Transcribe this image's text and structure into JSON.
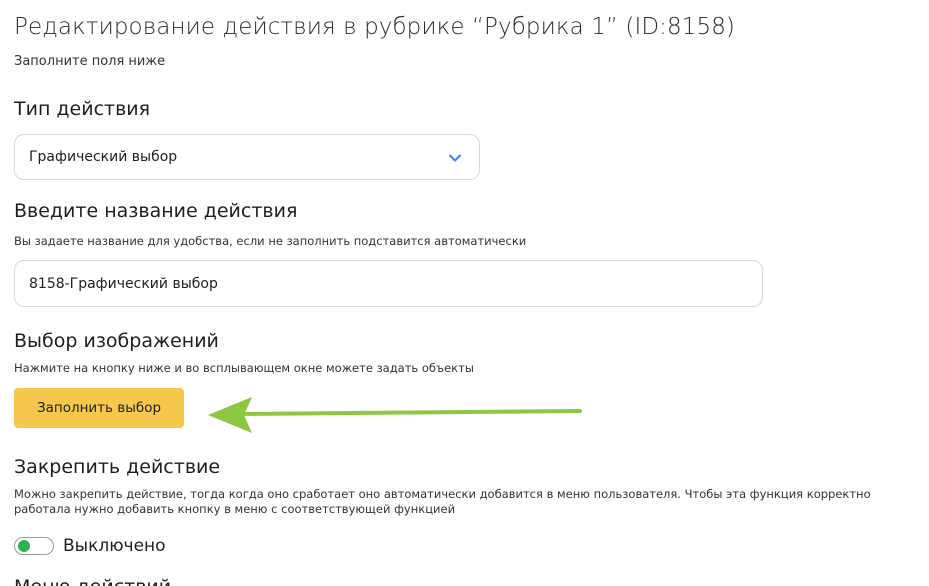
{
  "page": {
    "title": "Редактирование действия в рубрике “Рубрика 1” (ID:8158)",
    "subtitle": "Заполните поля ниже"
  },
  "action_type": {
    "label": "Тип действия",
    "selected_value": "Графический выбор"
  },
  "action_name": {
    "label": "Введите название действия",
    "hint": "Вы задаете название для удобства, если не заполнить подставится автоматически",
    "value": "8158-Графический выбор"
  },
  "image_selection": {
    "label": "Выбор изображений",
    "hint": "Нажмите на кнопку ниже и во всплывающем окне можете задать объекты",
    "button_label": "Заполнить выбор"
  },
  "pin_action": {
    "label": "Закрепить действие",
    "description": "Можно закрепить действие, тогда когда оно сработает оно автоматически добавится в меню пользователя. Чтобы эта функция корректно работала нужно добавить кнопку в меню с соответствующей функцией",
    "toggle_label": "Выключено",
    "toggle_on": false
  },
  "next_section": {
    "label": "Меню действий"
  },
  "colors": {
    "accent_button": "#f5c84c",
    "chevron": "#3b82f6",
    "toggle_knob": "#2bb34a",
    "arrow": "#8dc63f"
  },
  "icons": {
    "dropdown": "chevron-down-icon",
    "annotation": "arrow-left-icon"
  }
}
